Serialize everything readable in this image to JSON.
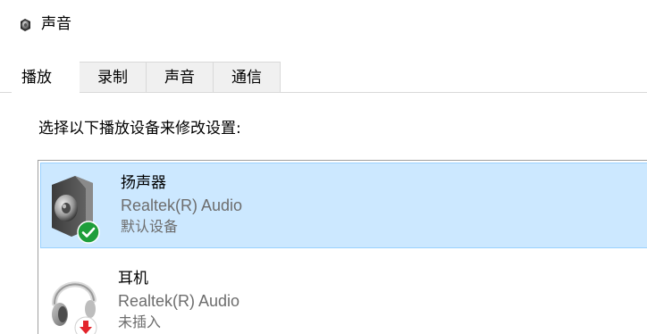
{
  "window": {
    "title": "声音",
    "icon": "speaker-icon"
  },
  "tabs": [
    {
      "label": "播放",
      "active": true
    },
    {
      "label": "录制",
      "active": false
    },
    {
      "label": "声音",
      "active": false
    },
    {
      "label": "通信",
      "active": false
    }
  ],
  "instruction": "选择以下播放设备来修改设置:",
  "devices": [
    {
      "name": "扬声器",
      "driver": "Realtek(R) Audio",
      "status": "默认设备",
      "icon": "speaker-device-icon",
      "badge": "green-check-icon",
      "selected": true
    },
    {
      "name": "耳机",
      "driver": "Realtek(R) Audio",
      "status": "未插入",
      "icon": "headphones-icon",
      "badge": "red-down-arrow-icon",
      "selected": false
    }
  ],
  "colors": {
    "selection_bg": "#cce8ff",
    "selection_border": "#99d1ff",
    "check_green": "#1e9e3a",
    "unplugged_red": "#e3242b"
  }
}
